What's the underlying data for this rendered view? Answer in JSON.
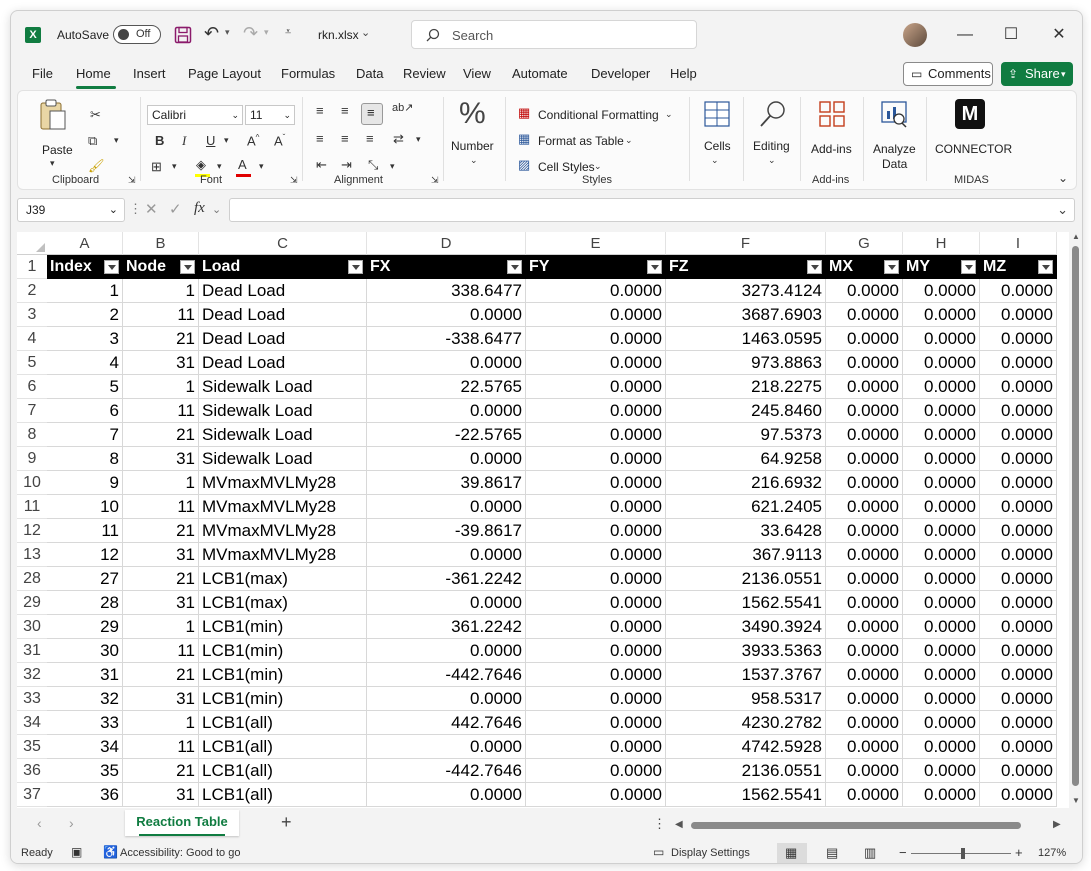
{
  "title_bar": {
    "app_icon": "excel-icon",
    "autosave_label": "AutoSave",
    "autosave_state": "Off",
    "file_name": "rkn.xlsx",
    "search_placeholder": "Search"
  },
  "menu": {
    "tabs": [
      "File",
      "Home",
      "Insert",
      "Page Layout",
      "Formulas",
      "Data",
      "Review",
      "View",
      "Automate",
      "Developer",
      "Help"
    ],
    "active_tab": "Home",
    "comments_label": "Comments",
    "share_label": "Share",
    "accent_color": "#107c41"
  },
  "ribbon": {
    "clipboard": {
      "paste_label": "Paste",
      "group_label": "Clipboard"
    },
    "font": {
      "font_name": "Calibri",
      "font_size": "11",
      "group_label": "Font"
    },
    "alignment": {
      "group_label": "Alignment"
    },
    "number": {
      "label": "Number",
      "icon": "%"
    },
    "styles": {
      "conditional_formatting": "Conditional Formatting",
      "format_as_table": "Format as Table",
      "cell_styles": "Cell Styles",
      "group_label": "Styles"
    },
    "cells": {
      "label": "Cells"
    },
    "editing": {
      "label": "Editing"
    },
    "addins": {
      "button_label": "Add-ins",
      "group_label": "Add-ins"
    },
    "analyze": {
      "line1": "Analyze",
      "line2": "Data"
    },
    "midas": {
      "button_label": "CONNECTOR",
      "group_label": "MIDAS",
      "logo_letter": "M"
    }
  },
  "formula_bar": {
    "name_box": "J39",
    "formula": "",
    "fx_label": "fx"
  },
  "sheet": {
    "columns": [
      "A",
      "B",
      "C",
      "D",
      "E",
      "F",
      "G",
      "H",
      "I"
    ],
    "headers": [
      "Index",
      "Node",
      "Load",
      "FX",
      "FY",
      "FZ",
      "MX",
      "MY",
      "MZ"
    ],
    "header_row_number": "1",
    "rows": [
      {
        "r": "2",
        "cells": [
          "1",
          "1",
          "Dead Load",
          "338.6477",
          "0.0000",
          "3273.4124",
          "0.0000",
          "0.0000",
          "0.0000"
        ]
      },
      {
        "r": "3",
        "cells": [
          "2",
          "11",
          "Dead Load",
          "0.0000",
          "0.0000",
          "3687.6903",
          "0.0000",
          "0.0000",
          "0.0000"
        ]
      },
      {
        "r": "4",
        "cells": [
          "3",
          "21",
          "Dead Load",
          "-338.6477",
          "0.0000",
          "1463.0595",
          "0.0000",
          "0.0000",
          "0.0000"
        ]
      },
      {
        "r": "5",
        "cells": [
          "4",
          "31",
          "Dead Load",
          "0.0000",
          "0.0000",
          "973.8863",
          "0.0000",
          "0.0000",
          "0.0000"
        ]
      },
      {
        "r": "6",
        "cells": [
          "5",
          "1",
          "Sidewalk Load",
          "22.5765",
          "0.0000",
          "218.2275",
          "0.0000",
          "0.0000",
          "0.0000"
        ]
      },
      {
        "r": "7",
        "cells": [
          "6",
          "11",
          "Sidewalk Load",
          "0.0000",
          "0.0000",
          "245.8460",
          "0.0000",
          "0.0000",
          "0.0000"
        ]
      },
      {
        "r": "8",
        "cells": [
          "7",
          "21",
          "Sidewalk Load",
          "-22.5765",
          "0.0000",
          "97.5373",
          "0.0000",
          "0.0000",
          "0.0000"
        ]
      },
      {
        "r": "9",
        "cells": [
          "8",
          "31",
          "Sidewalk Load",
          "0.0000",
          "0.0000",
          "64.9258",
          "0.0000",
          "0.0000",
          "0.0000"
        ]
      },
      {
        "r": "10",
        "cells": [
          "9",
          "1",
          "MVmaxMVLMy28",
          "39.8617",
          "0.0000",
          "216.6932",
          "0.0000",
          "0.0000",
          "0.0000"
        ]
      },
      {
        "r": "11",
        "cells": [
          "10",
          "11",
          "MVmaxMVLMy28",
          "0.0000",
          "0.0000",
          "621.2405",
          "0.0000",
          "0.0000",
          "0.0000"
        ]
      },
      {
        "r": "12",
        "cells": [
          "11",
          "21",
          "MVmaxMVLMy28",
          "-39.8617",
          "0.0000",
          "33.6428",
          "0.0000",
          "0.0000",
          "0.0000"
        ]
      },
      {
        "r": "13",
        "cells": [
          "12",
          "31",
          "MVmaxMVLMy28",
          "0.0000",
          "0.0000",
          "367.9113",
          "0.0000",
          "0.0000",
          "0.0000"
        ]
      },
      {
        "r": "28",
        "cells": [
          "27",
          "21",
          "LCB1(max)",
          "-361.2242",
          "0.0000",
          "2136.0551",
          "0.0000",
          "0.0000",
          "0.0000"
        ]
      },
      {
        "r": "29",
        "cells": [
          "28",
          "31",
          "LCB1(max)",
          "0.0000",
          "0.0000",
          "1562.5541",
          "0.0000",
          "0.0000",
          "0.0000"
        ]
      },
      {
        "r": "30",
        "cells": [
          "29",
          "1",
          "LCB1(min)",
          "361.2242",
          "0.0000",
          "3490.3924",
          "0.0000",
          "0.0000",
          "0.0000"
        ]
      },
      {
        "r": "31",
        "cells": [
          "30",
          "11",
          "LCB1(min)",
          "0.0000",
          "0.0000",
          "3933.5363",
          "0.0000",
          "0.0000",
          "0.0000"
        ]
      },
      {
        "r": "32",
        "cells": [
          "31",
          "21",
          "LCB1(min)",
          "-442.7646",
          "0.0000",
          "1537.3767",
          "0.0000",
          "0.0000",
          "0.0000"
        ]
      },
      {
        "r": "33",
        "cells": [
          "32",
          "31",
          "LCB1(min)",
          "0.0000",
          "0.0000",
          "958.5317",
          "0.0000",
          "0.0000",
          "0.0000"
        ]
      },
      {
        "r": "34",
        "cells": [
          "33",
          "1",
          "LCB1(all)",
          "442.7646",
          "0.0000",
          "4230.2782",
          "0.0000",
          "0.0000",
          "0.0000"
        ]
      },
      {
        "r": "35",
        "cells": [
          "34",
          "11",
          "LCB1(all)",
          "0.0000",
          "0.0000",
          "4742.5928",
          "0.0000",
          "0.0000",
          "0.0000"
        ]
      },
      {
        "r": "36",
        "cells": [
          "35",
          "21",
          "LCB1(all)",
          "-442.7646",
          "0.0000",
          "2136.0551",
          "0.0000",
          "0.0000",
          "0.0000"
        ]
      },
      {
        "r": "37",
        "cells": [
          "36",
          "31",
          "LCB1(all)",
          "0.0000",
          "0.0000",
          "1562.5541",
          "0.0000",
          "0.0000",
          "0.0000"
        ]
      }
    ]
  },
  "sheet_tabs": {
    "active": "Reaction Table",
    "add_icon": "+"
  },
  "status_bar": {
    "ready": "Ready",
    "accessibility": "Accessibility: Good to go",
    "display_settings": "Display Settings",
    "zoom_minus": "−",
    "zoom_plus": "+",
    "zoom": "127%"
  }
}
